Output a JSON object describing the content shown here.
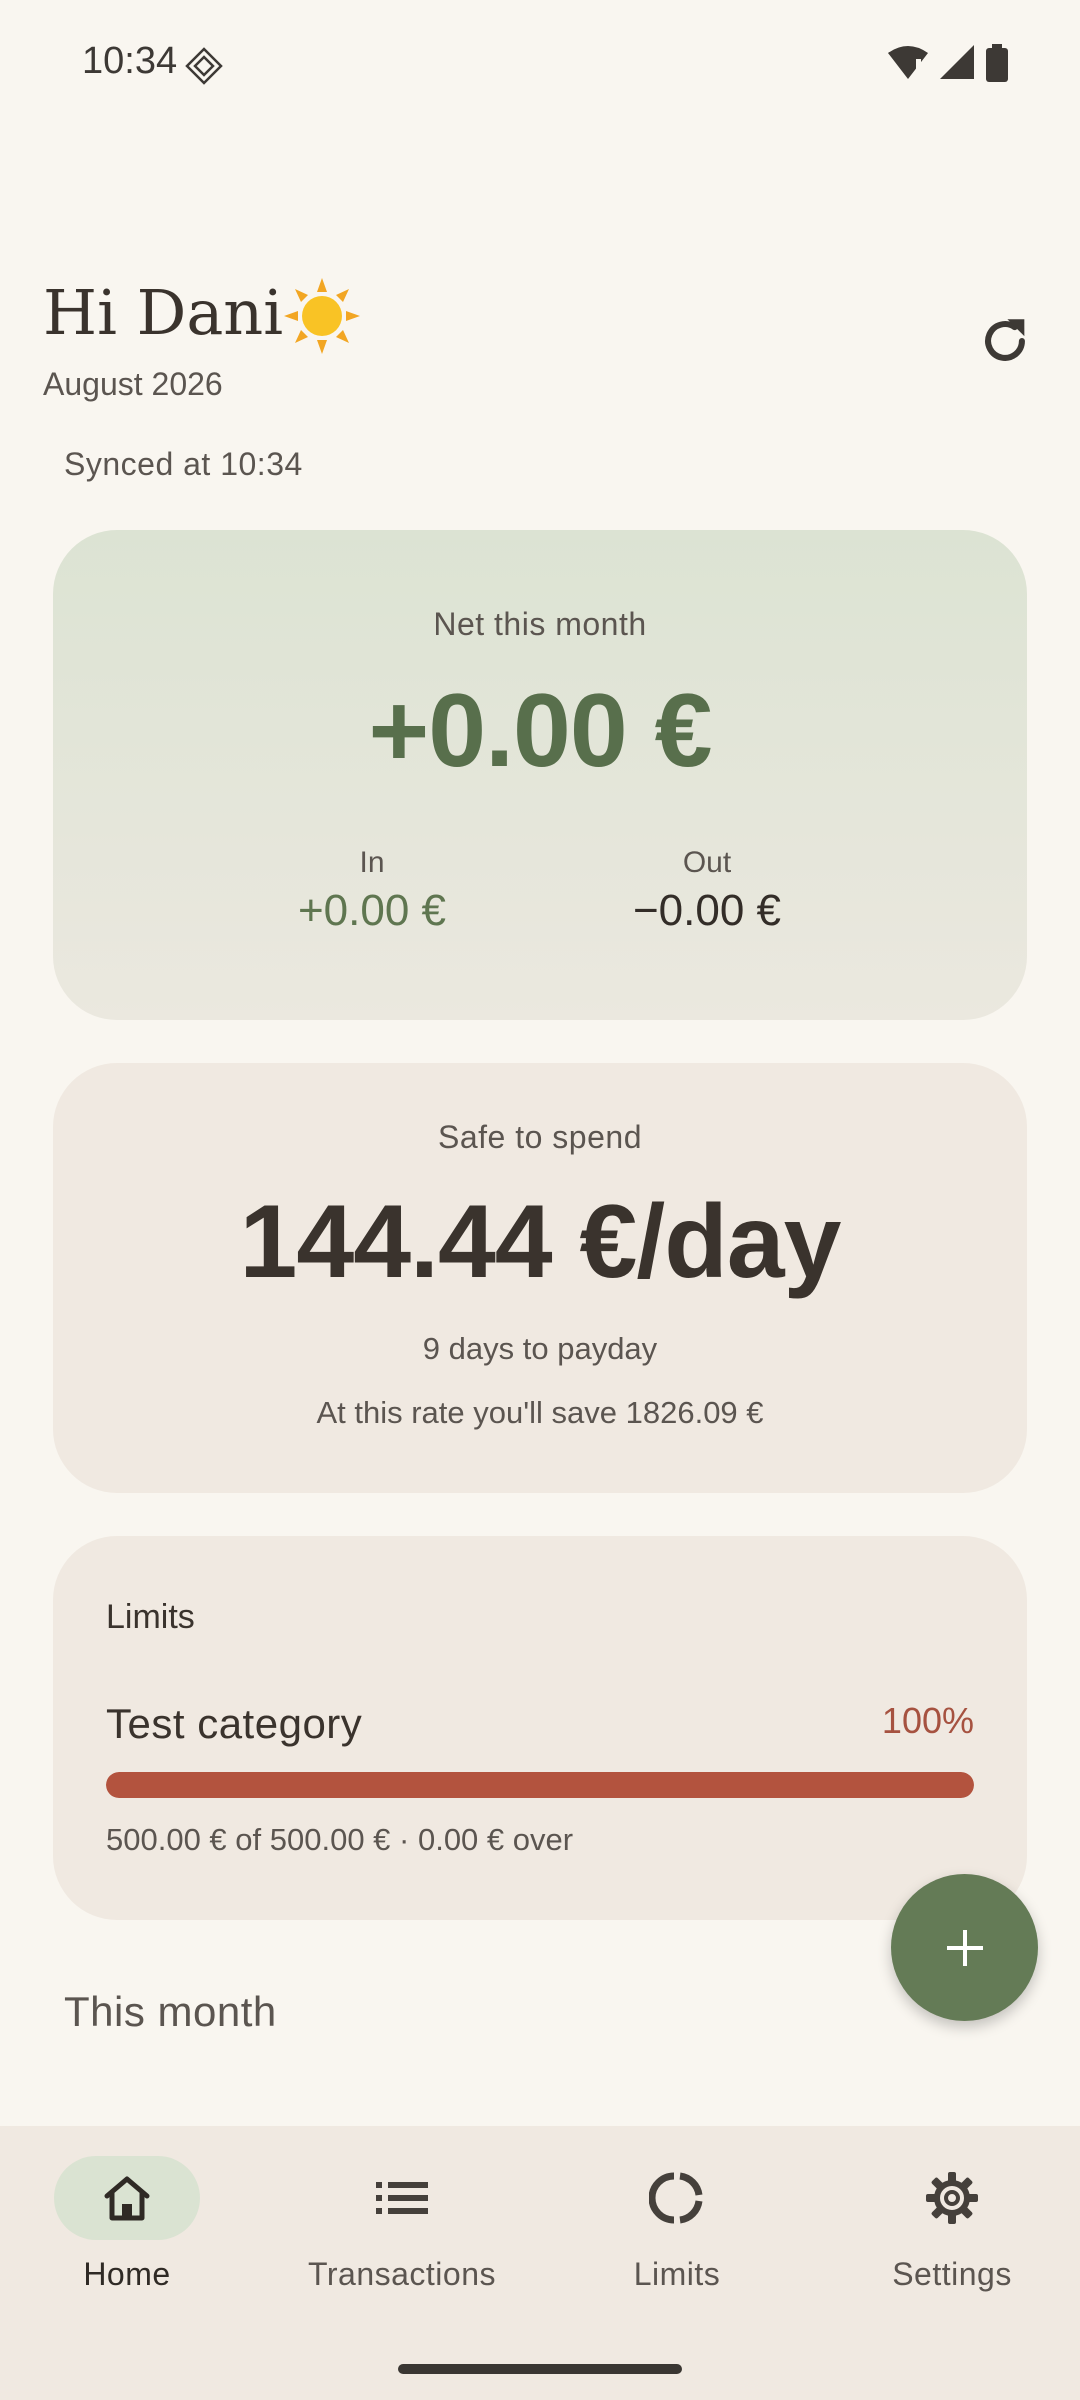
{
  "status_bar": {
    "time": "10:34",
    "icons": [
      "wifi-icon",
      "signal-icon",
      "battery-icon"
    ]
  },
  "header": {
    "greeting": "Hi Dani",
    "greeting_icon": "sun-icon",
    "month": "August 2026",
    "refresh_icon": "refresh-icon",
    "synced": "Synced at 10:34"
  },
  "net_card": {
    "label": "Net this month",
    "value": "+0.00 €",
    "in_label": "In",
    "in_value": "+0.00 €",
    "out_label": "Out",
    "out_value": "−0.00 €"
  },
  "safe_card": {
    "label": "Safe to spend",
    "value": "144.44 €/day",
    "payday": "9 days to payday",
    "save_rate": "At this rate you'll save 1826.09 €"
  },
  "limits_card": {
    "title": "Limits",
    "items": [
      {
        "name": "Test category",
        "percent_label": "100%",
        "progress": 1.0,
        "detail": "500.00 € of 500.00 € · 0.00 € over"
      }
    ]
  },
  "section": {
    "heading": "This month"
  },
  "fab": {
    "icon": "plus-icon"
  },
  "nav": {
    "items": [
      {
        "label": "Home",
        "icon": "home-icon",
        "active": true
      },
      {
        "label": "Transactions",
        "icon": "list-icon",
        "active": false
      },
      {
        "label": "Limits",
        "icon": "donut-icon",
        "active": false
      },
      {
        "label": "Settings",
        "icon": "gear-icon",
        "active": false
      }
    ]
  },
  "colors": {
    "accent_green": "#647b56",
    "net_text": "#586f4c",
    "over_limit": "#b3533e",
    "background": "#f9f6f0",
    "card": "#f0e9e1"
  }
}
